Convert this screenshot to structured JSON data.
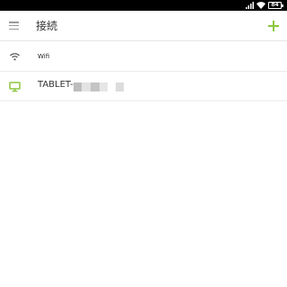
{
  "toolbar": {
    "title": "接続"
  },
  "status_bar": {
    "battery": "84"
  },
  "connections": [
    {
      "label": "Wifi",
      "icon": "wifi-icon"
    },
    {
      "label": "TABLET-",
      "icon": "monitor-icon"
    }
  ],
  "colors": {
    "accent": "#8cc63f",
    "status_bar": "#000000"
  }
}
